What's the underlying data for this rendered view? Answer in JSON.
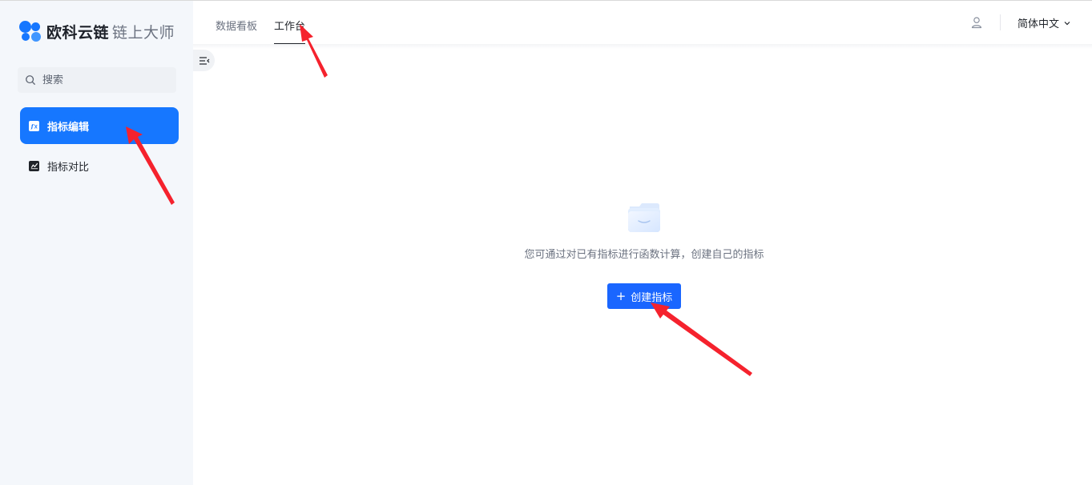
{
  "brand": {
    "name": "欧科云链",
    "product": "链上大师",
    "color": "#1677ff"
  },
  "sidebar": {
    "search": {
      "placeholder": "搜索",
      "value": "",
      "icon": "search-icon"
    },
    "items": [
      {
        "label": "指标编辑",
        "icon": "function-icon",
        "active": true
      },
      {
        "label": "指标对比",
        "icon": "chart-icon",
        "active": false
      }
    ]
  },
  "header": {
    "tabs": [
      {
        "label": "数据看板",
        "active": false
      },
      {
        "label": "工作台",
        "active": true
      }
    ],
    "user_icon": "user-icon",
    "language": {
      "label": "简体中文",
      "icon": "chevron-down-icon"
    }
  },
  "main": {
    "collapse_icon": "menu-collapse-icon",
    "empty_state": {
      "illustration": "empty-folder-icon",
      "message": "您可通过对已有指标进行函数计算，创建自己的指标",
      "button_label": "创建指标",
      "button_icon": "plus-icon"
    }
  },
  "colors": {
    "accent": "#1677ff",
    "button": "#1a66ff",
    "sidebar_bg": "#f4f7fb",
    "annotation": "#f5222d"
  }
}
